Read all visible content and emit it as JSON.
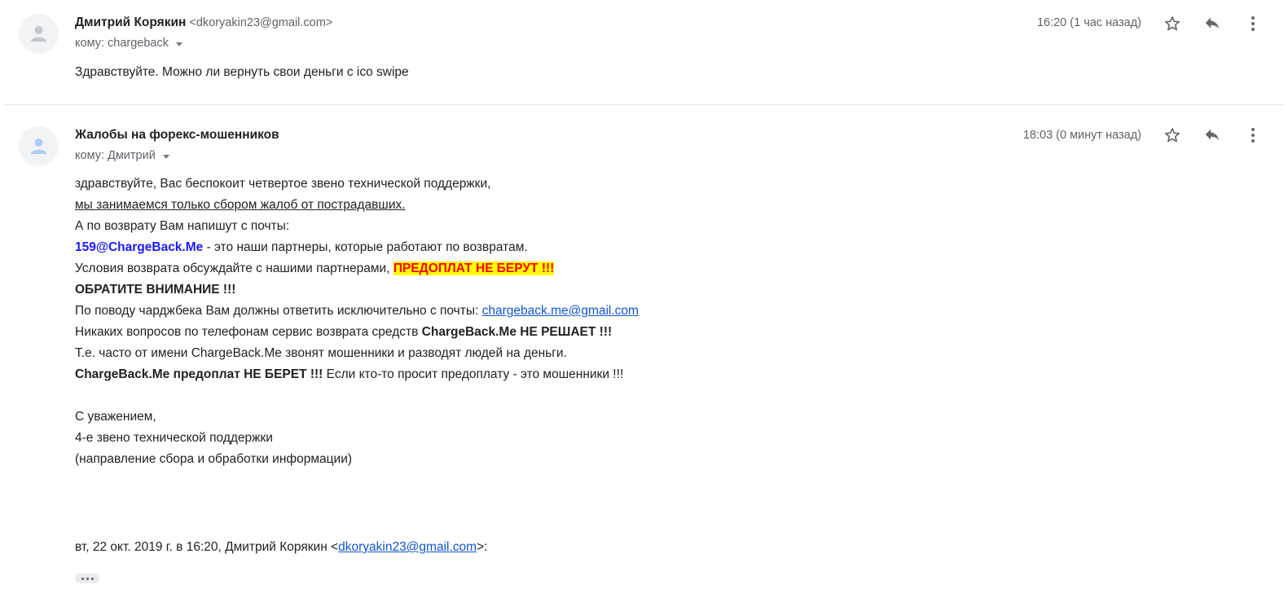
{
  "messages": [
    {
      "sender_name": "Дмитрий Корякин",
      "sender_email": "<dkoryakin23@gmail.com>",
      "to": "кому: chargeback",
      "timestamp": "16:20 (1 час назад)",
      "body": "Здравствуйте. Можно ли вернуть свои деньги с ico swipe"
    },
    {
      "sender_name": "Жалобы на форекс-мошенников",
      "to": "кому: Дмитрий",
      "timestamp": "18:03 (0 минут назад)",
      "lines": {
        "l1": "здравствуйте, Вас беспокоит четвертое звено технической поддержки,",
        "l2": "мы занимаемся только сбором жалоб от пострадавших.",
        "l3": "А по возврату Вам напишут с почты:",
        "l4_email": "159@ChargeBack.Me",
        "l4_rest": " - это наши партнеры, которые работают по возвратам.",
        "l5_pre": "Условия возврата обсуждайте с нашими партнерами, ",
        "l5_highlight": "ПРЕДОПЛАТ НЕ БЕРУТ !!!",
        "l6": "ОБРАТИТЕ ВНИМАНИЕ !!!",
        "l7_pre": "По поводу чарджбека Вам должны ответить исключительно с почты: ",
        "l7_link": "chargeback.me@gmail.com",
        "l8_pre": "Никаких вопросов по телефонам сервис возврата средств ",
        "l8_bold": "ChargeBack.Me НЕ РЕШАЕТ !!!",
        "l9": "Т.е. часто от имени ChargeBack.Me звонят мошенники и разводят людей на деньги.",
        "l10_bold": "ChargeBack.Me предоплат НЕ БЕРЕТ !!!",
        "l10_rest": " Если кто-то просит предоплату - это мошенники !!!",
        "sig1": "С уважением,",
        "sig2": "4-е звено технической поддержки",
        "sig3": "(направление сбора и обработки информации)",
        "quote_pre": "вт, 22 окт. 2019 г. в 16:20, Дмитрий Корякин <",
        "quote_link": "dkoryakin23@gmail.com",
        "quote_post": ">:"
      }
    }
  ],
  "icons": {
    "star": "star-icon",
    "reply": "reply-icon",
    "more": "more-vert-icon",
    "avatar": "person-icon",
    "show_trimmed": "ellipsis-icon"
  },
  "colors": {
    "highlight_bg": "#ffff00",
    "highlight_text": "#ff0000",
    "email_blue": "#1a1aff",
    "link": "#1155cc"
  }
}
